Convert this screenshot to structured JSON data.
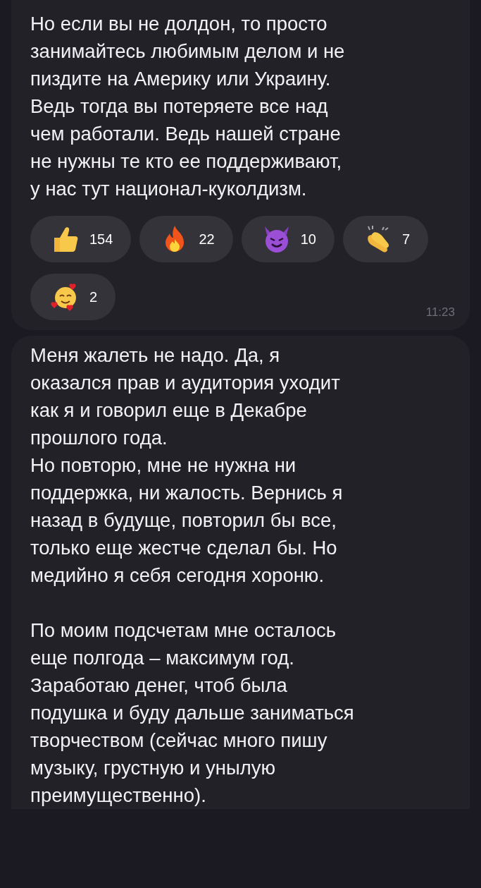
{
  "messages": [
    {
      "text": "Но если вы не долдон, то просто\nзанимайтесь любимым делом и не\nпиздите на Америку или Украину.\nВедь тогда вы потеряете все над\nчем работали. Ведь нашей стране\nне нужны те кто ее поддерживают,\nу нас тут национал-куколдизм.",
      "reactions": [
        {
          "count": "154"
        },
        {
          "count": "22"
        },
        {
          "count": "10"
        },
        {
          "count": "7"
        },
        {
          "count": "2"
        }
      ],
      "time": "11:23"
    },
    {
      "text": "Меня жалеть не надо. Да, я\nоказался прав и аудитория уходит\nкак я и говорил еще в Декабре\nпрошлого года.\nНо повторю, мне не нужна ни\nподдержка, ни жалость. Вернись я\nназад в будуще, повторил бы все,\nтолько еще жестче сделал бы. Но\nмедийно я себя сегодня хороню.\n\nПо моим подсчетам мне осталось\nеще полгода – максимум год.\nЗаработаю денег, чтоб была\nподушка и буду дальше заниматься\nтворчеством (сейчас много пишу\nмузыку, грустную и унылую\nпреимущественно)."
    }
  ]
}
